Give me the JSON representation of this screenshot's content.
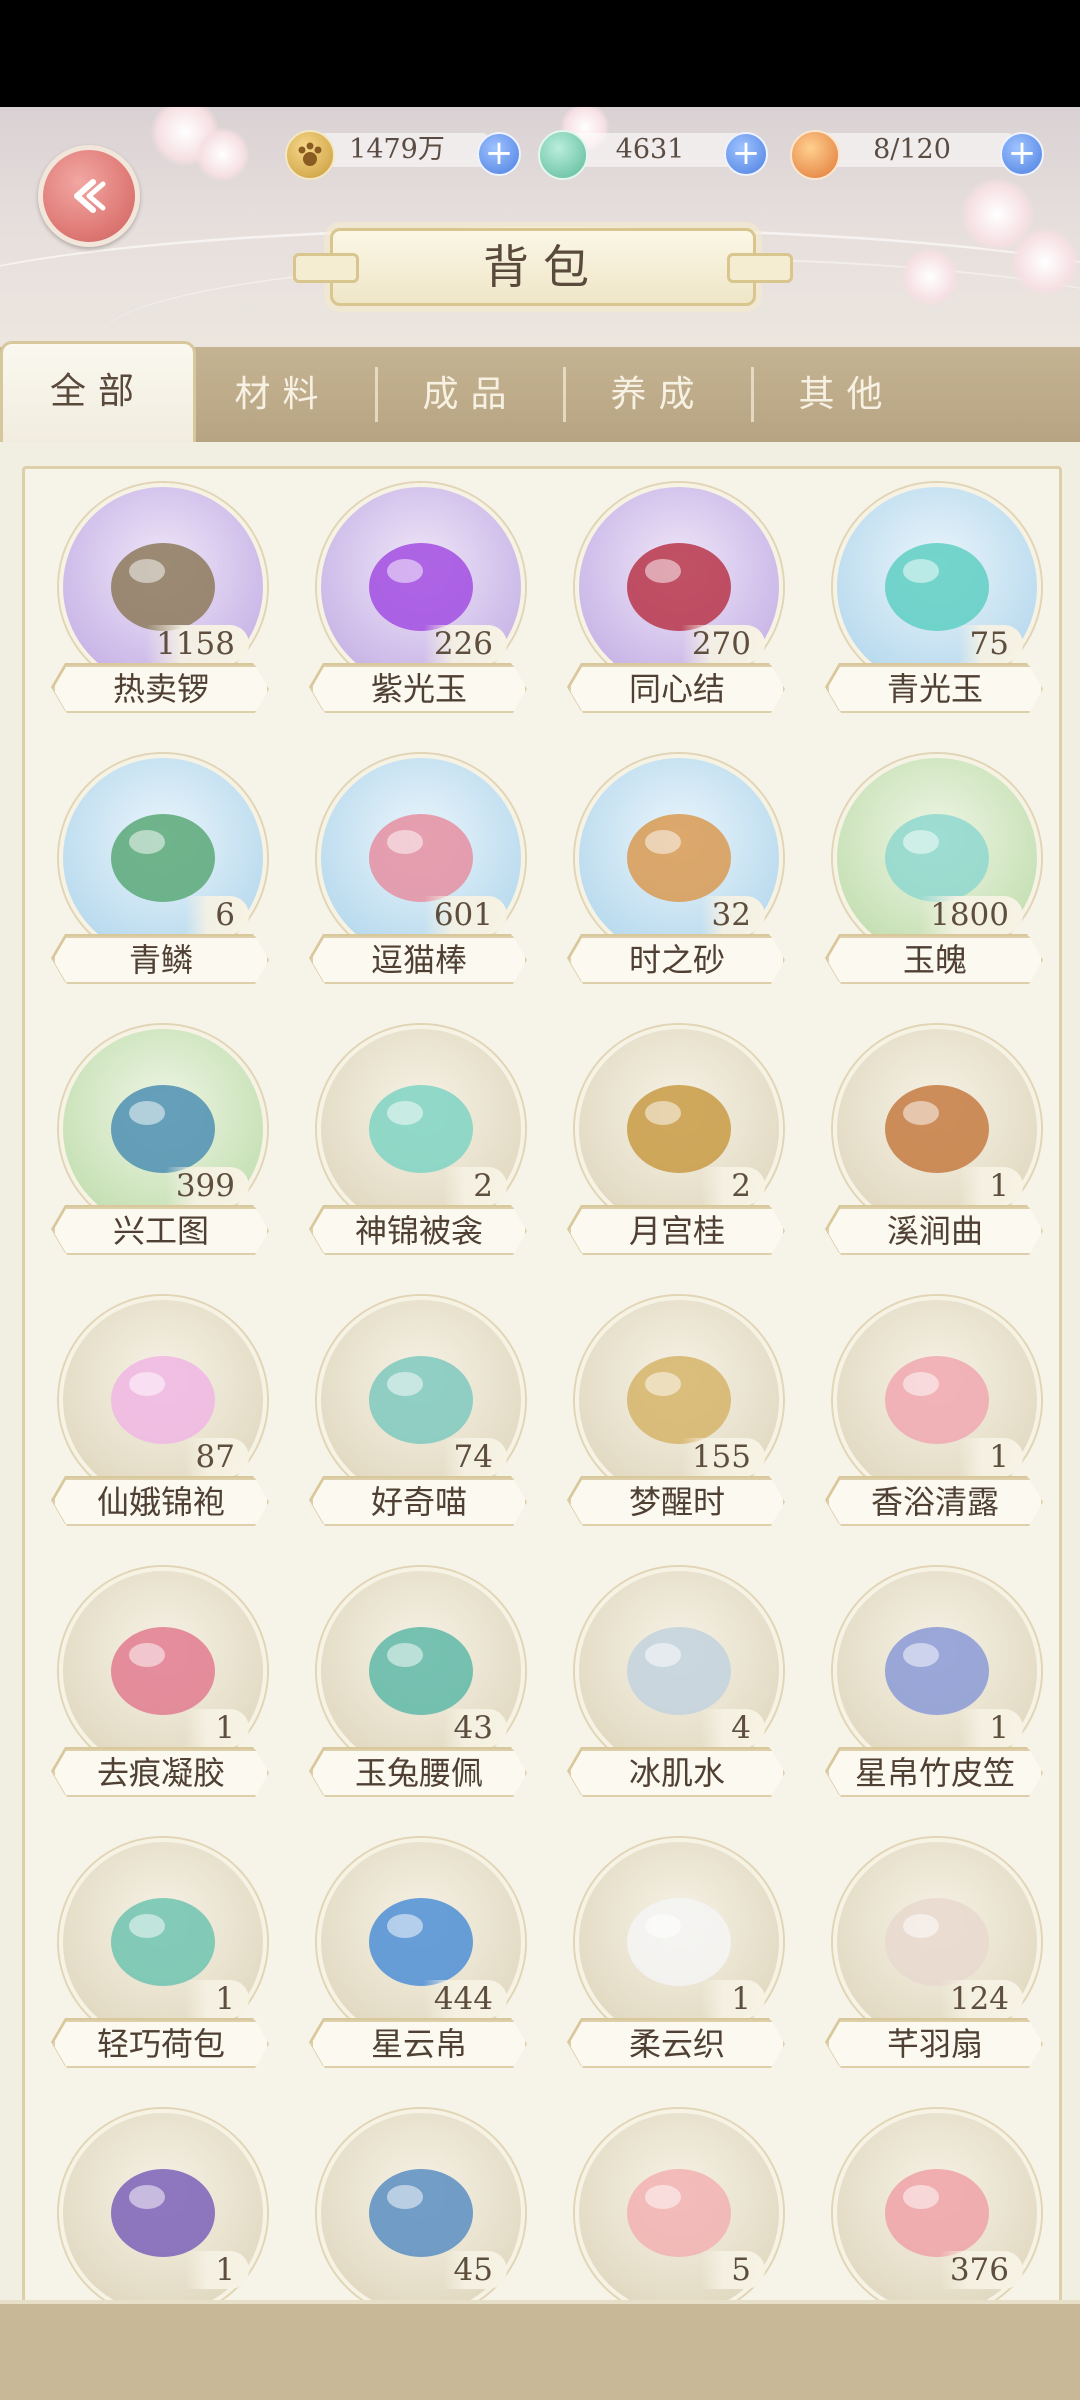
{
  "header": {
    "title": "背包",
    "resources": [
      {
        "icon": "paw-coin-icon",
        "value": "1479万"
      },
      {
        "icon": "jade-gem-icon",
        "value": "4631"
      },
      {
        "icon": "food-bowl-icon",
        "value": "8/120"
      }
    ]
  },
  "tabs": [
    {
      "label": "全部",
      "active": true
    },
    {
      "label": "材料",
      "active": false
    },
    {
      "label": "成品",
      "active": false
    },
    {
      "label": "养成",
      "active": false
    },
    {
      "label": "其他",
      "active": false
    }
  ],
  "items": [
    {
      "name": "热卖锣",
      "count": "1158",
      "bg": "purple",
      "icon": "gong-icon"
    },
    {
      "name": "紫光玉",
      "count": "226",
      "bg": "purple",
      "icon": "purple-jade-fish-icon"
    },
    {
      "name": "同心结",
      "count": "270",
      "bg": "purple",
      "icon": "chinese-knot-icon"
    },
    {
      "name": "青光玉",
      "count": "75",
      "bg": "blue",
      "icon": "green-jade-fish-icon"
    },
    {
      "name": "青鳞",
      "count": "6",
      "bg": "blue",
      "icon": "green-scales-icon"
    },
    {
      "name": "逗猫棒",
      "count": "601",
      "bg": "blue",
      "icon": "cat-teaser-icon"
    },
    {
      "name": "时之砂",
      "count": "32",
      "bg": "blue",
      "icon": "hourglass-icon"
    },
    {
      "name": "玉魄",
      "count": "1800",
      "bg": "green",
      "icon": "jade-disc-icon"
    },
    {
      "name": "兴工图",
      "count": "399",
      "bg": "green",
      "icon": "scroll-map-icon"
    },
    {
      "name": "神锦被衾",
      "count": "2",
      "bg": "neutral",
      "icon": "quilt-icon"
    },
    {
      "name": "月宫桂",
      "count": "2",
      "bg": "neutral",
      "icon": "hairpin-icon"
    },
    {
      "name": "溪涧曲",
      "count": "1",
      "bg": "neutral",
      "icon": "ornament-hairpin-icon"
    },
    {
      "name": "仙娥锦袍",
      "count": "87",
      "bg": "neutral",
      "icon": "robe-icon"
    },
    {
      "name": "好奇喵",
      "count": "74",
      "bg": "neutral",
      "icon": "cat-powder-box-icon"
    },
    {
      "name": "梦醒时",
      "count": "155",
      "bg": "neutral",
      "icon": "powder-compact-icon"
    },
    {
      "name": "香浴清露",
      "count": "1",
      "bg": "neutral",
      "icon": "gourd-bottle-icon"
    },
    {
      "name": "去痕凝胶",
      "count": "1",
      "bg": "neutral",
      "icon": "cream-jar-icon"
    },
    {
      "name": "玉兔腰佩",
      "count": "43",
      "bg": "neutral",
      "icon": "jade-pendant-icon"
    },
    {
      "name": "冰肌水",
      "count": "4",
      "bg": "neutral",
      "icon": "vase-icon"
    },
    {
      "name": "星帛竹皮笠",
      "count": "1",
      "bg": "neutral",
      "icon": "bamboo-hat-icon"
    },
    {
      "name": "轻巧荷包",
      "count": "1",
      "bg": "neutral",
      "icon": "pouch-icon"
    },
    {
      "name": "星云帛",
      "count": "444",
      "bg": "neutral",
      "icon": "blue-silk-icon"
    },
    {
      "name": "柔云织",
      "count": "1",
      "bg": "neutral",
      "icon": "white-cloth-icon"
    },
    {
      "name": "芊羽扇",
      "count": "124",
      "bg": "neutral",
      "icon": "folding-fan-icon"
    },
    {
      "name": "",
      "count": "1",
      "bg": "neutral",
      "icon": "purple-pouch-icon"
    },
    {
      "name": "",
      "count": "45",
      "bg": "neutral",
      "icon": "scroll-brush-icon"
    },
    {
      "name": "",
      "count": "5",
      "bg": "neutral",
      "icon": "round-fan-icon"
    },
    {
      "name": "",
      "count": "376",
      "bg": "neutral",
      "icon": "pink-silk-icon"
    }
  ],
  "colors": {
    "purple": "#c9b6e6",
    "blue": "#b9d8ec",
    "green": "#c6dfb6",
    "neutral": "#e3dcc6",
    "tab_bar": "#bfae8c",
    "accent_blue": "#4c7fe0"
  }
}
